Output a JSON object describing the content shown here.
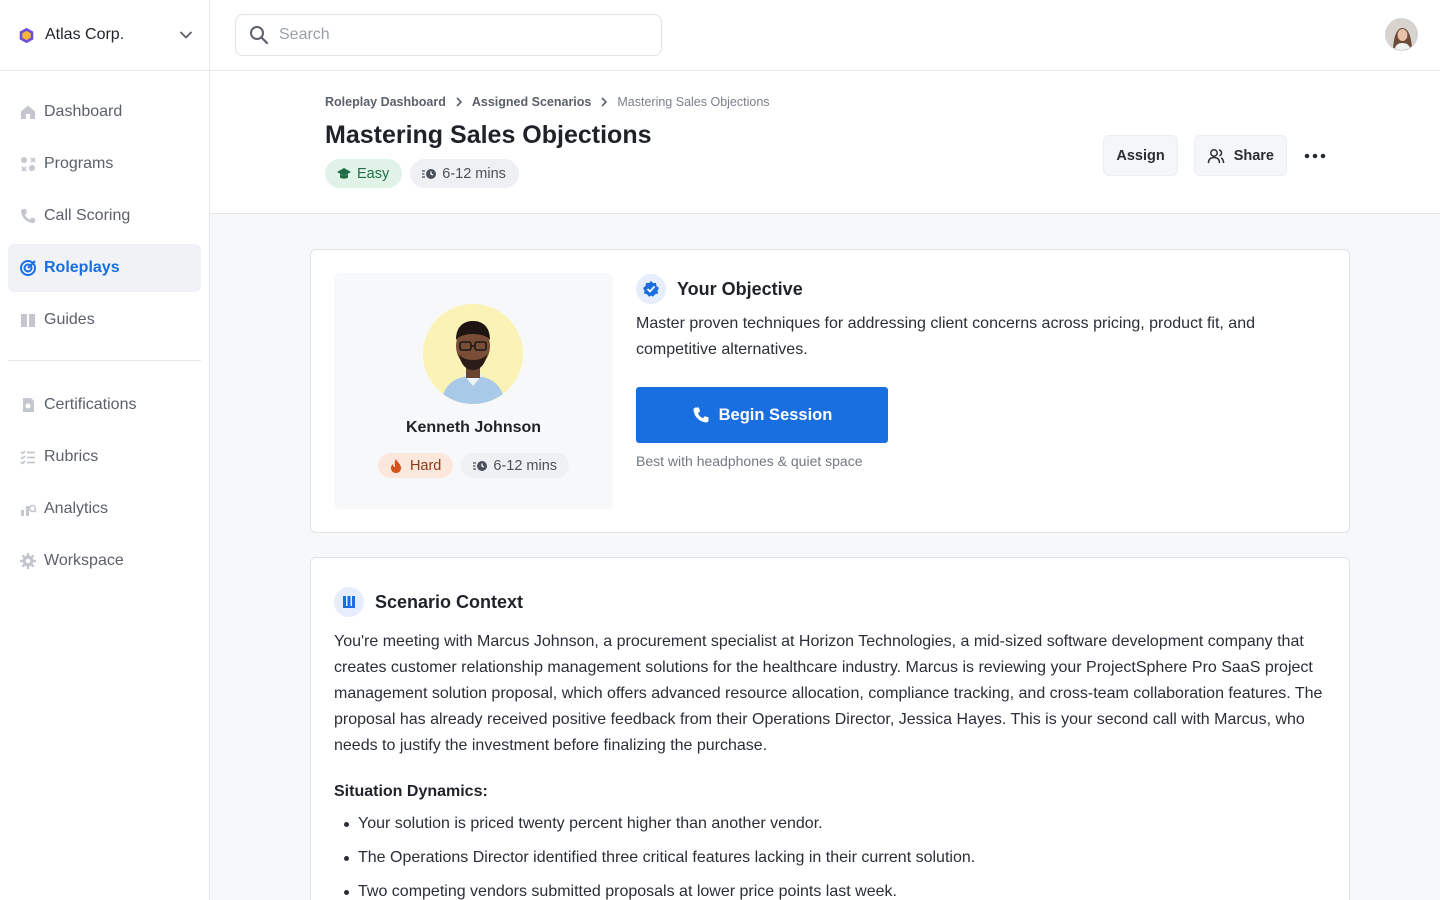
{
  "org": {
    "name": "Atlas Corp.",
    "logo_icon": "hexagon-logo-icon",
    "chevron_icon": "chevron-down-icon"
  },
  "sidebar": {
    "items": [
      {
        "label": "Dashboard",
        "icon": "home-icon",
        "active": false
      },
      {
        "label": "Programs",
        "icon": "programs-icon",
        "active": false
      },
      {
        "label": "Call Scoring",
        "icon": "phone-icon",
        "active": false
      },
      {
        "label": "Roleplays",
        "icon": "target-icon",
        "active": true
      },
      {
        "label": "Guides",
        "icon": "book-icon",
        "active": false
      }
    ],
    "secondary": [
      {
        "label": "Certifications",
        "icon": "certificate-icon"
      },
      {
        "label": "Rubrics",
        "icon": "checklist-icon"
      },
      {
        "label": "Analytics",
        "icon": "analytics-icon"
      },
      {
        "label": "Workspace",
        "icon": "gear-icon"
      }
    ]
  },
  "topbar": {
    "search_placeholder": "Search",
    "search_value": ""
  },
  "breadcrumb": [
    "Roleplay Dashboard",
    "Assigned Scenarios",
    "Mastering Sales Objections"
  ],
  "page": {
    "title": "Mastering Sales Objections",
    "difficulty": "Easy",
    "duration": "6-12 mins"
  },
  "actions": {
    "assign": "Assign",
    "share": "Share"
  },
  "persona": {
    "name": "Kenneth Johnson",
    "difficulty": "Hard",
    "duration": "6-12 mins"
  },
  "objective": {
    "title": "Your Objective",
    "text": "Master proven techniques for addressing client concerns across pricing, product fit, and competitive alternatives.",
    "button": "Begin Session",
    "hint": "Best with headphones & quiet space"
  },
  "context": {
    "title": "Scenario Context",
    "text": "You're meeting with Marcus Johnson, a procurement specialist at Horizon Technologies, a mid-sized software development company that creates customer relationship management solutions for the healthcare industry. Marcus is reviewing your ProjectSphere Pro SaaS project management solution proposal, which offers advanced resource allocation, compliance tracking, and cross-team collaboration features. The proposal has already received positive feedback from their Operations Director, Jessica Hayes. This is your second call with Marcus, who needs to justify the investment before finalizing the purchase.",
    "dynamics_title": "Situation Dynamics:",
    "dynamics": [
      "Your solution is priced twenty percent higher than another vendor.",
      "The Operations Director identified three critical features lacking in their current solution.",
      "Two competing vendors submitted proposals at lower price points last week."
    ]
  },
  "colors": {
    "accent": "#1a6fe0",
    "easy_bg": "#e1f3e9",
    "hard_bg": "#fbe7dc"
  }
}
